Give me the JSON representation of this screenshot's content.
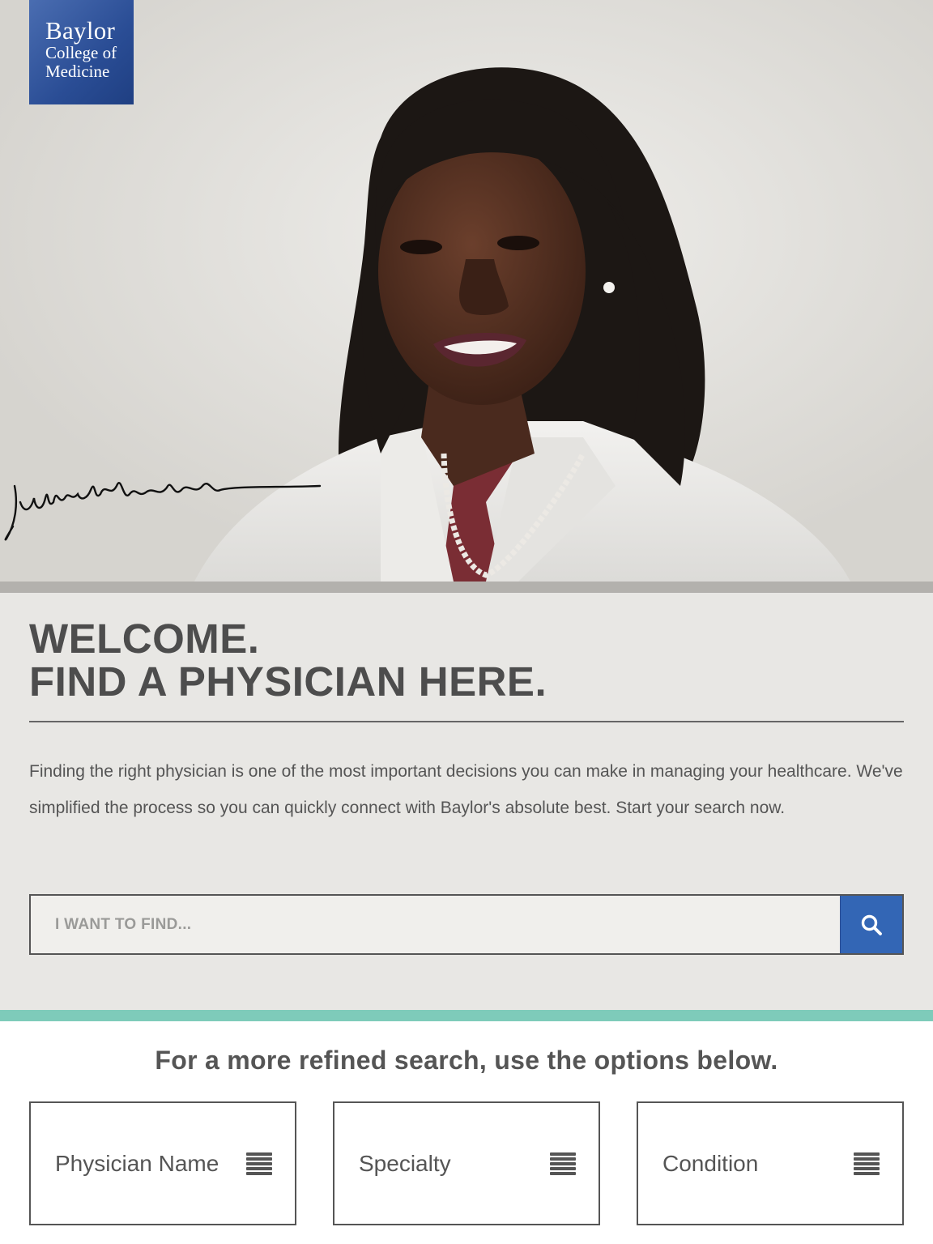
{
  "logo": {
    "line1": "Baylor",
    "line2": "College of",
    "line3": "Medicine"
  },
  "hero": {
    "photo_icon": "physician-portrait",
    "signature_icon": "handwritten-signature"
  },
  "welcome": {
    "headline_line1": "WELCOME.",
    "headline_line2": "FIND A PHYSICIAN HERE.",
    "intro": "Finding the right physician is one of the most important decisions you can make in managing your healthcare. We've simplified the process so you can quickly connect with Baylor's absolute best. Start your search now."
  },
  "search": {
    "placeholder": "I WANT TO FIND...",
    "value": "",
    "button_icon": "search-icon"
  },
  "refine": {
    "title": "For a more refined search, use the options below.",
    "options": [
      {
        "label": "Physician Name",
        "icon": "list-icon"
      },
      {
        "label": "Specialty",
        "icon": "list-icon"
      },
      {
        "label": "Condition",
        "icon": "list-icon"
      }
    ]
  },
  "colors": {
    "brand_blue": "#3366b5",
    "logo_blue": "#2a4d95",
    "accent_teal": "#7ecbba",
    "section_bg": "#e8e7e4",
    "text_dark": "#4d4d4d"
  }
}
